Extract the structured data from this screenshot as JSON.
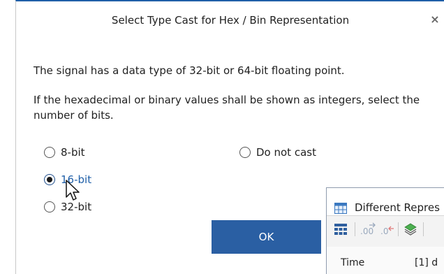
{
  "dialog": {
    "title": "Select Type Cast for Hex / Bin Representation",
    "close_glyph": "×",
    "message_line1": "The signal has a data type of 32-bit or 64-bit floating point.",
    "message_line2": "If the hexadecimal or binary values shall be shown as integers, select the number of bits.",
    "options": [
      {
        "label": "8-bit",
        "selected": false
      },
      {
        "label": "16-bit",
        "selected": true
      },
      {
        "label": "32-bit",
        "selected": false
      },
      {
        "label": "Do not cast",
        "selected": false
      }
    ],
    "ok_label": "OK"
  },
  "background_window": {
    "title": "Different Repres",
    "columns": [
      "Time",
      "[1] d"
    ],
    "toolbar_icons": [
      "table-icon",
      "decimal-places-increase-icon",
      "decimal-places-decrease-icon",
      "layers-icon"
    ]
  },
  "colors": {
    "accent": "#2a5fa3",
    "selected_label": "#1f5fa8"
  }
}
